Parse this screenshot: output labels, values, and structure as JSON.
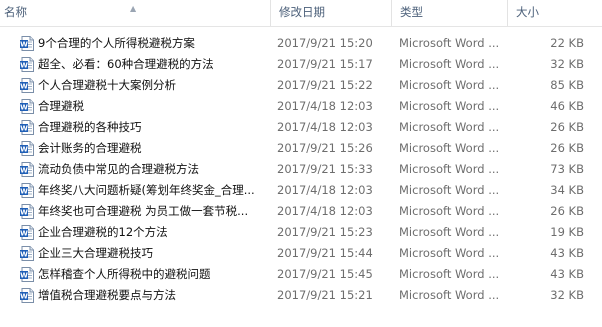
{
  "columns": {
    "name": "名称",
    "date": "修改日期",
    "type": "类型",
    "size": "大小"
  },
  "icon_name": "word-document-icon",
  "files": [
    {
      "name": "9个合理的个人所得税避税方案",
      "date": "2017/9/21 15:20",
      "type": "Microsoft Word ...",
      "size": "22 KB"
    },
    {
      "name": "超全、必看：60种合理避税的方法",
      "date": "2017/9/21 15:17",
      "type": "Microsoft Word ...",
      "size": "32 KB"
    },
    {
      "name": "个人合理避税十大案例分析",
      "date": "2017/9/21 15:22",
      "type": "Microsoft Word ...",
      "size": "85 KB"
    },
    {
      "name": "合理避税",
      "date": "2017/4/18 12:03",
      "type": "Microsoft Word ...",
      "size": "46 KB"
    },
    {
      "name": "合理避税的各种技巧",
      "date": "2017/4/18 12:03",
      "type": "Microsoft Word ...",
      "size": "26 KB"
    },
    {
      "name": "会计账务的合理避税",
      "date": "2017/9/21 15:26",
      "type": "Microsoft Word ...",
      "size": "26 KB"
    },
    {
      "name": "流动负债中常见的合理避税方法",
      "date": "2017/9/21 15:33",
      "type": "Microsoft Word ...",
      "size": "73 KB"
    },
    {
      "name": "年终奖八大问题析疑(筹划年终奖金_合理...",
      "date": "2017/4/18 12:03",
      "type": "Microsoft Word ...",
      "size": "34 KB"
    },
    {
      "name": "年终奖也可合理避税 为员工做一套节税...",
      "date": "2017/4/18 12:03",
      "type": "Microsoft Word ...",
      "size": "26 KB"
    },
    {
      "name": "企业合理避税的12个方法",
      "date": "2017/9/21 15:23",
      "type": "Microsoft Word ...",
      "size": "19 KB"
    },
    {
      "name": "企业三大合理避税技巧",
      "date": "2017/9/21 15:44",
      "type": "Microsoft Word ...",
      "size": "43 KB"
    },
    {
      "name": "怎样稽查个人所得税中的避税问题",
      "date": "2017/9/21 15:45",
      "type": "Microsoft Word ...",
      "size": "43 KB"
    },
    {
      "name": "增值税合理避税要点与方法",
      "date": "2017/9/21 15:21",
      "type": "Microsoft Word ...",
      "size": "32 KB"
    }
  ]
}
